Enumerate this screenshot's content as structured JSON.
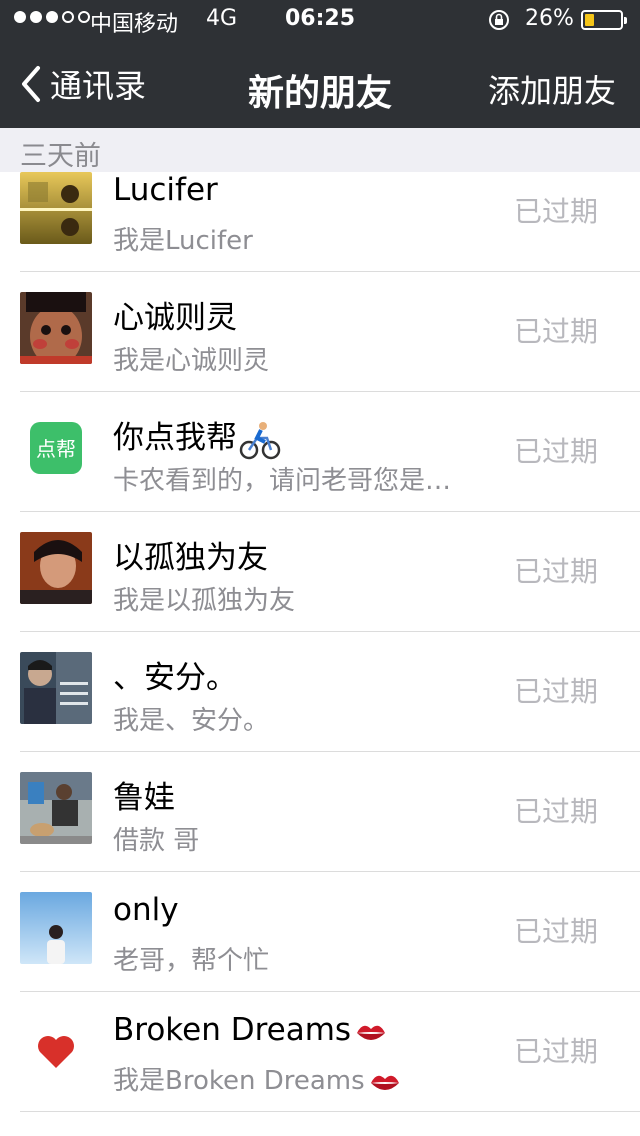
{
  "status_bar": {
    "signal_full": 3,
    "signal_total": 5,
    "carrier": "中国移动",
    "network": "4G",
    "time": "06:25",
    "battery_percent": "26%",
    "battery_level": 0.26,
    "battery_color": "#f5c518"
  },
  "nav": {
    "back_label": "通讯录",
    "title": "新的朋友",
    "action_label": "添加朋友"
  },
  "section_header": "三天前",
  "friend_requests": [
    {
      "name": "Lucifer",
      "message": "我是Lucifer",
      "status": "已过期",
      "avatar": "sunset-photo-avatar",
      "name_emoji": "",
      "message_emoji": ""
    },
    {
      "name": "心诚则灵",
      "message": "我是心诚则灵",
      "status": "已过期",
      "avatar": "child-face-avatar",
      "name_emoji": "",
      "message_emoji": ""
    },
    {
      "name": "你点我帮",
      "message": "卡农看到的，请问老哥您是…",
      "status": "已过期",
      "avatar": "dianbang-app-logo",
      "avatar_text": "点帮",
      "avatar_color": "#3dbf6a",
      "name_emoji": "cyclist-emoji",
      "message_emoji": ""
    },
    {
      "name": "以孤独为友",
      "message": "我是以孤独为友",
      "status": "已过期",
      "avatar": "portrait-avatar",
      "name_emoji": "",
      "message_emoji": ""
    },
    {
      "name": "、安分。",
      "message": "我是、安分。",
      "status": "已过期",
      "avatar": "keep-calm-photo-avatar",
      "name_emoji": "",
      "message_emoji": ""
    },
    {
      "name": "鲁娃",
      "message": "借款 哥",
      "status": "已过期",
      "avatar": "person-with-dog-avatar",
      "name_emoji": "",
      "message_emoji": ""
    },
    {
      "name": "only",
      "message": "老哥，帮个忙",
      "status": "已过期",
      "avatar": "sky-person-avatar",
      "name_emoji": "",
      "message_emoji": ""
    },
    {
      "name": "Broken Dreams",
      "message": "我是Broken Dreams",
      "status": "已过期",
      "avatar": "red-heart-avatar",
      "name_emoji": "kiss-mark-emoji",
      "message_emoji": "kiss-mark-emoji"
    }
  ]
}
